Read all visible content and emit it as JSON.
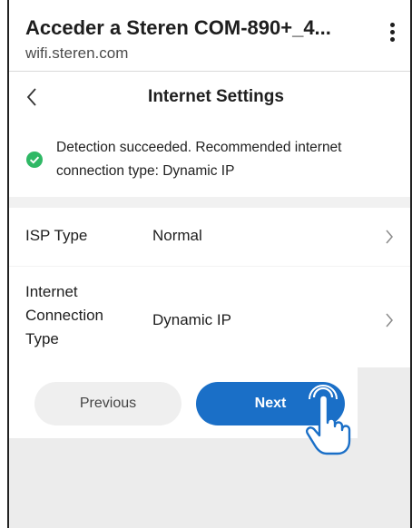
{
  "browser": {
    "title": "Acceder a Steren COM-890+_4...",
    "url": "wifi.steren.com",
    "menu_icon": "kebab-menu-icon"
  },
  "page": {
    "title": "Internet Settings",
    "back_icon": "chevron-left-icon"
  },
  "banner": {
    "icon": "check-circle-icon",
    "icon_color": "#2fb865",
    "text": "Detection succeeded. Recommended internet connection type: Dynamic IP"
  },
  "settings": {
    "rows": [
      {
        "label": "ISP Type",
        "value": "Normal"
      },
      {
        "label_lines": [
          "Internet",
          "Connection",
          "Type"
        ],
        "value": "Dynamic IP"
      }
    ]
  },
  "buttons": {
    "previous_label": "Previous",
    "next_label": "Next",
    "next_color": "#1a6fc7"
  },
  "overlay": {
    "icon": "pointing-hand-icon"
  }
}
